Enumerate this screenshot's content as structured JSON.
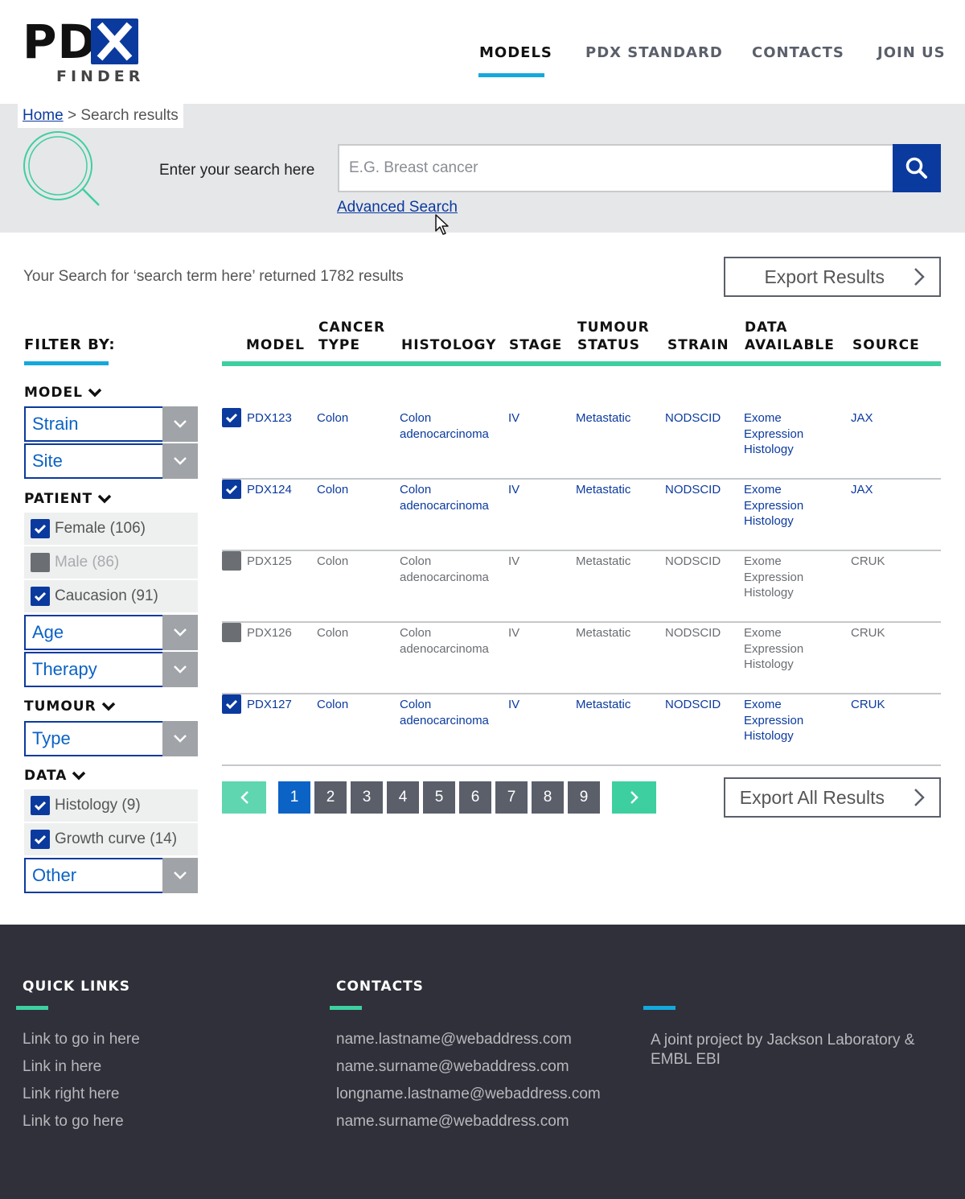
{
  "header": {
    "logo_pd": "PD",
    "logo_finder": "FINDER",
    "nav": [
      "MODELS",
      "PDX STANDARD",
      "CONTACTS",
      "JOIN US"
    ]
  },
  "breadcrumb": {
    "home": "Home",
    "separator": ">",
    "current": "Search results"
  },
  "search": {
    "label": "Enter your search here",
    "placeholder": "E.G. Breast cancer",
    "advanced": "Advanced Search"
  },
  "results": {
    "summary": "Your Search for ‘search term here’ returned 1782 results",
    "export_label": "Export Results",
    "export_all_label": "Export All Results"
  },
  "filter": {
    "title": "FILTER BY:",
    "model": {
      "heading": "MODEL",
      "selects": [
        "Strain",
        "Site"
      ]
    },
    "patient": {
      "heading": "PATIENT",
      "checks": [
        {
          "label": "Female (106)",
          "checked": true
        },
        {
          "label": "Male (86)",
          "checked": false
        },
        {
          "label": "Caucasion (91)",
          "checked": true
        }
      ],
      "selects": [
        "Age",
        "Therapy"
      ]
    },
    "tumour": {
      "heading": "TUMOUR",
      "selects": [
        "Type"
      ]
    },
    "data": {
      "heading": "DATA",
      "checks": [
        {
          "label": "Histology (9)",
          "checked": true
        },
        {
          "label": "Growth curve (14)",
          "checked": true
        }
      ],
      "selects": [
        "Other"
      ]
    }
  },
  "table": {
    "columns": [
      "MODEL",
      "CANCER TYPE",
      "HISTOLOGY",
      "STAGE",
      "TUMOUR STATUS",
      "STRAIN",
      "DATA AVAILABLE",
      "SOURCE"
    ],
    "rows": [
      {
        "checked": true,
        "model": "PDX123",
        "cancer": "Colon",
        "histology": [
          "Colon",
          "adenocarcinoma"
        ],
        "stage": "IV",
        "status": "Metastatic",
        "strain": "NODSCID",
        "data": [
          "Exome",
          "Expression",
          "Histology"
        ],
        "source": "JAX"
      },
      {
        "checked": true,
        "model": "PDX124",
        "cancer": "Colon",
        "histology": [
          "Colon",
          "adenocarcinoma"
        ],
        "stage": "IV",
        "status": "Metastatic",
        "strain": "NODSCID",
        "data": [
          "Exome",
          "Expression",
          "Histology"
        ],
        "source": "JAX"
      },
      {
        "checked": false,
        "model": "PDX125",
        "cancer": "Colon",
        "histology": [
          "Colon",
          "adenocarcinoma"
        ],
        "stage": "IV",
        "status": "Metastatic",
        "strain": "NODSCID",
        "data": [
          "Exome",
          "Expression",
          "Histology"
        ],
        "source": "CRUK"
      },
      {
        "checked": false,
        "model": "PDX126",
        "cancer": "Colon",
        "histology": [
          "Colon",
          "adenocarcinoma"
        ],
        "stage": "IV",
        "status": "Metastatic",
        "strain": "NODSCID",
        "data": [
          "Exome",
          "Expression",
          "Histology"
        ],
        "source": "CRUK"
      },
      {
        "checked": true,
        "model": "PDX127",
        "cancer": "Colon",
        "histology": [
          "Colon",
          "adenocarcinoma"
        ],
        "stage": "IV",
        "status": "Metastatic",
        "strain": "NODSCID",
        "data": [
          "Exome",
          "Expression",
          "Histology"
        ],
        "source": "CRUK"
      }
    ]
  },
  "pagination": {
    "pages": [
      "1",
      "2",
      "3",
      "4",
      "5",
      "6",
      "7",
      "8",
      "9"
    ],
    "current": "1"
  },
  "footer": {
    "quick_links": {
      "heading": "QUICK LINKS",
      "links": [
        "Link to go in here",
        "Link in here",
        "Link right here",
        "Link to go here"
      ]
    },
    "contacts": {
      "heading": "CONTACTS",
      "emails": [
        "name.lastname@webaddress.com",
        "name.surname@webaddress.com",
        "longname.lastname@webaddress.com",
        "name.surname@webaddress.com"
      ]
    },
    "about": "A joint project by Jackson Laboratory & EMBL EBI"
  },
  "colors": {
    "brand_blue": "#0b3a9e",
    "link_blue": "#0b63c5",
    "accent_cyan": "#14a8dc",
    "accent_green": "#3ecfa0",
    "footer_bg": "#2f3039"
  }
}
